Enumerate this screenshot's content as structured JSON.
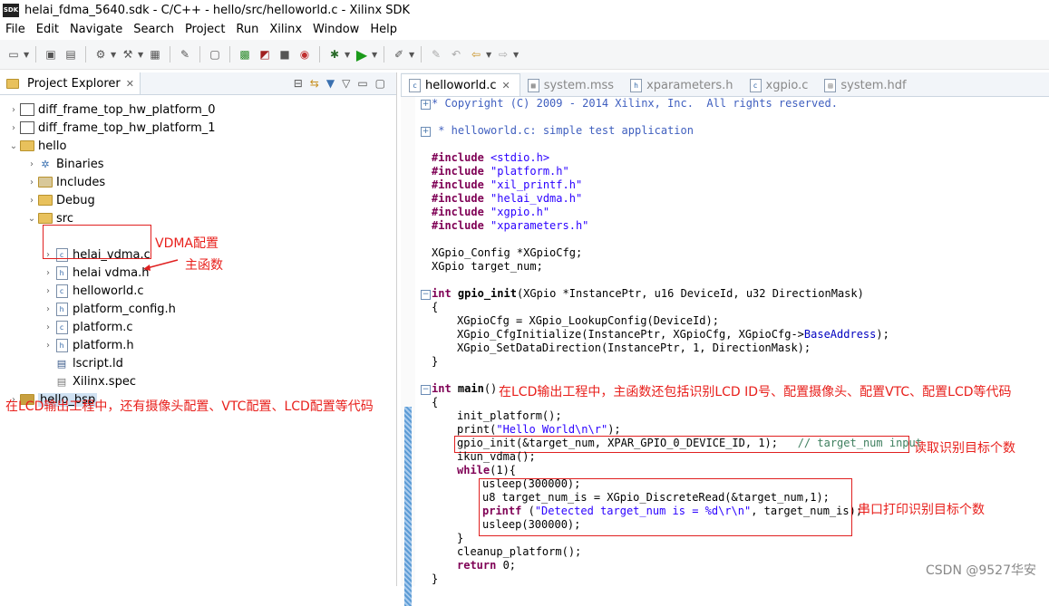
{
  "window": {
    "title": "helai_fdma_5640.sdk - C/C++ - hello/src/helloworld.c - Xilinx SDK",
    "app_icon_text": "SDK"
  },
  "menu": [
    "File",
    "Edit",
    "Navigate",
    "Search",
    "Project",
    "Run",
    "Xilinx",
    "Window",
    "Help"
  ],
  "project_explorer": {
    "title": "Project Explorer",
    "tree": [
      {
        "label": "diff_frame_top_hw_platform_0",
        "icon": "project-icon",
        "arrow": "›"
      },
      {
        "label": "diff_frame_top_hw_platform_1",
        "icon": "project-icon",
        "arrow": "›"
      },
      {
        "label": "hello",
        "icon": "c-project-icon",
        "arrow": "⌄"
      },
      {
        "label": "Binaries",
        "icon": "binaries-icon",
        "arrow": "›"
      },
      {
        "label": "Includes",
        "icon": "includes-icon",
        "arrow": "›"
      },
      {
        "label": "Debug",
        "icon": "folder-icon",
        "arrow": "›"
      },
      {
        "label": "src",
        "icon": "folder-icon",
        "arrow": "⌄"
      },
      {
        "label": "helai_vdma.c",
        "icon": "c-file-icon",
        "arrow": "›"
      },
      {
        "label": "helai vdma.h",
        "icon": "h-file-icon",
        "arrow": "›"
      },
      {
        "label": "helloworld.c",
        "icon": "c-file-icon",
        "arrow": "›"
      },
      {
        "label": "platform_config.h",
        "icon": "h-file-icon",
        "arrow": "›"
      },
      {
        "label": "platform.c",
        "icon": "c-file-icon",
        "arrow": "›"
      },
      {
        "label": "platform.h",
        "icon": "h-file-icon",
        "arrow": "›"
      },
      {
        "label": "lscript.ld",
        "icon": "linker-file-icon",
        "arrow": ""
      },
      {
        "label": "Xilinx.spec",
        "icon": "spec-file-icon",
        "arrow": ""
      },
      {
        "label": "hello_bsp",
        "icon": "bsp-project-icon",
        "arrow": "›"
      }
    ]
  },
  "annotations": {
    "vdma_config": "VDMA配置",
    "main_function": "主函数",
    "lcd_note_left": "在LCD输出工程中，还有摄像头配置、VTC配置、LCD配置等代码",
    "lcd_note_main": "在LCD输出工程中，主函数还包括识别LCD ID号、配置摄像头、配置VTC、配置LCD等代码",
    "read_count": "读取识别目标个数",
    "serial_print": "串口打印识别目标个数"
  },
  "editor": {
    "tabs": [
      {
        "label": "helloworld.c",
        "icon": "c-file-icon",
        "active": true
      },
      {
        "label": "system.mss",
        "icon": "mss-file-icon",
        "active": false
      },
      {
        "label": "xparameters.h",
        "icon": "h-file-icon",
        "active": false
      },
      {
        "label": "xgpio.c",
        "icon": "c-file-icon",
        "active": false
      },
      {
        "label": "system.hdf",
        "icon": "hdf-file-icon",
        "active": false
      }
    ],
    "code": {
      "l1": "* Copyright (C) 2009 - 2014 Xilinx, Inc.  All rights reserved.",
      "l2": " * helloworld.c: simple test application",
      "inc_kw": "#include",
      "inc1": "<stdio.h>",
      "inc2": "\"platform.h\"",
      "inc3": "\"xil_printf.h\"",
      "inc4": "\"helai_vdma.h\"",
      "inc5": "\"xgpio.h\"",
      "inc6": "\"xparameters.h\"",
      "decl1": "XGpio_Config *XGpioCfg;",
      "decl2": "XGpio target_num;",
      "f1_kw": "int",
      "f1_name": "gpio_init",
      "f1_args": "(XGpio *InstancePtr, u16 DeviceId, u32 DirectionMask)",
      "open": "{",
      "close": "}",
      "g1": "XGpioCfg = XGpio_LookupConfig(DeviceId);",
      "g2a": "XGpio_CfgInitialize(InstancePtr, XGpioCfg, XGpioCfg->",
      "g2b": "BaseAddress",
      "g2c": ");",
      "g3": "XGpio_SetDataDirection(InstancePtr, 1, DirectionMask);",
      "m_kw": "int",
      "m_name": "main",
      "m_args": "()",
      "m1": "init_platform();",
      "m2a": "print(",
      "m2b": "\"Hello World\\n\\r\"",
      "m2c": ");",
      "m3a": "gpio_init(&target_num, XPAR_GPIO_0_DEVICE_ID, 1);",
      "m3b": "// target_num input",
      "m4": "ikun_vdma();",
      "m5a": "while",
      "m5b": "(1){",
      "w1": "usleep(300000);",
      "w2": "u8 target_num_is = XGpio_DiscreteRead(&target_num,1);",
      "w3a": "printf",
      "w3b": " (",
      "w3c": "\"Detected ",
      "w3d": "target_num",
      "w3e": " is = %d\\r\\n\"",
      "w3f": ", target_num_is);",
      "w4": "usleep(300000);",
      "m6": "cleanup_platform();",
      "m7a": "return",
      "m7b": " 0;"
    }
  },
  "watermark": "CSDN @9527华安"
}
